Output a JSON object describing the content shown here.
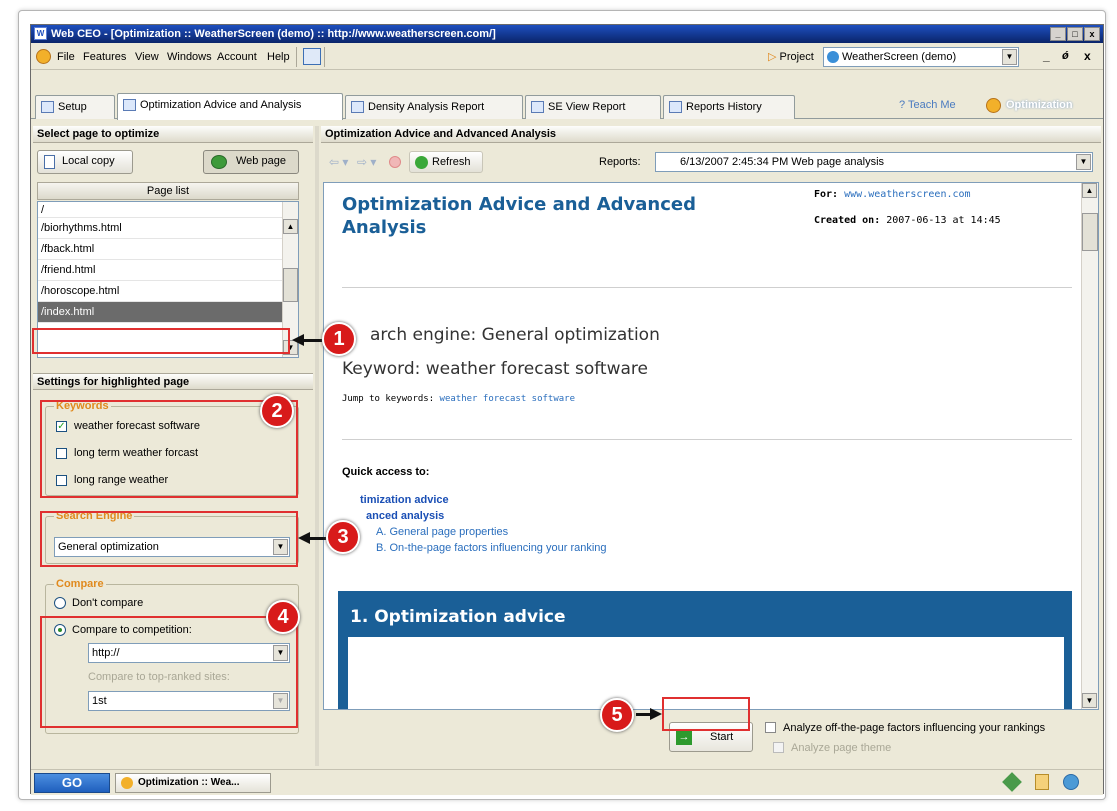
{
  "window": {
    "title": "Web CEO - [Optimization :: WeatherScreen (demo) :: http://www.weatherscreen.com/]",
    "app_icon": "W",
    "controls": [
      "_",
      "□",
      "x"
    ]
  },
  "menu": {
    "items": [
      "File",
      "Features",
      "View",
      "Windows",
      "Account",
      "Help"
    ],
    "project_label": "Project",
    "project_value": "WeatherScreen (demo)",
    "mdi_controls": [
      "_",
      "ǿ",
      "x"
    ]
  },
  "tabs": [
    {
      "label": "Setup"
    },
    {
      "label": "Optimization Advice and Analysis"
    },
    {
      "label": "Density Analysis Report"
    },
    {
      "label": "SE View Report"
    },
    {
      "label": "Reports History"
    }
  ],
  "tab_right": {
    "teach_me": "Teach Me",
    "optimization": "Optimization"
  },
  "left": {
    "select_header": "Select page to optimize",
    "local_copy": "Local copy",
    "web_page": "Web page",
    "page_list_header": "Page list",
    "pages": [
      "/",
      "/biorhythms.html",
      "/fback.html",
      "/friend.html",
      "/horoscope.html",
      "/index.html"
    ],
    "settings_header": "Settings for highlighted page",
    "keywords_label": "Keywords",
    "keywords": [
      {
        "label": "weather forecast software",
        "checked": true
      },
      {
        "label": "long term weather forcast",
        "checked": false
      },
      {
        "label": "long range weather",
        "checked": false
      }
    ],
    "search_engine_label": "Search Engine",
    "search_engine_value": "General optimization",
    "compare_label": "Compare",
    "dont_compare": "Don't compare",
    "compare_competition": "Compare to competition:",
    "competition_url": "http://",
    "compare_top": "Compare to top-ranked sites:",
    "top_value": "1st"
  },
  "right": {
    "header": "Optimization Advice and Advanced Analysis",
    "refresh": "Refresh",
    "reports_label": "Reports:",
    "reports_value": "6/13/2007 2:45:34 PM Web page analysis",
    "doc": {
      "title": "Optimization Advice and Advanced Analysis",
      "for_label": "For:",
      "for_value": "www.weatherscreen.com",
      "created_label": "Created on:",
      "created_value": "2007-06-13 at 14:45",
      "search_engine": "arch engine: General optimization",
      "keyword": "Keyword: weather forecast software",
      "jump_label": "Jump to keywords:",
      "jump_link": "weather forecast software",
      "quick_access": "Quick access to:",
      "qa_items": [
        "timization advice",
        "anced analysis",
        "A. General page properties",
        "B. On-the-page factors influencing your ranking"
      ],
      "section_title": "1. Optimization advice"
    },
    "start": "Start",
    "offpage": "Analyze off-the-page factors influencing your rankings",
    "theme": "Analyze page theme"
  },
  "taskbar": {
    "go": "GO",
    "item": "Optimization :: Wea..."
  },
  "markers": [
    "1",
    "2",
    "3",
    "4",
    "5"
  ]
}
